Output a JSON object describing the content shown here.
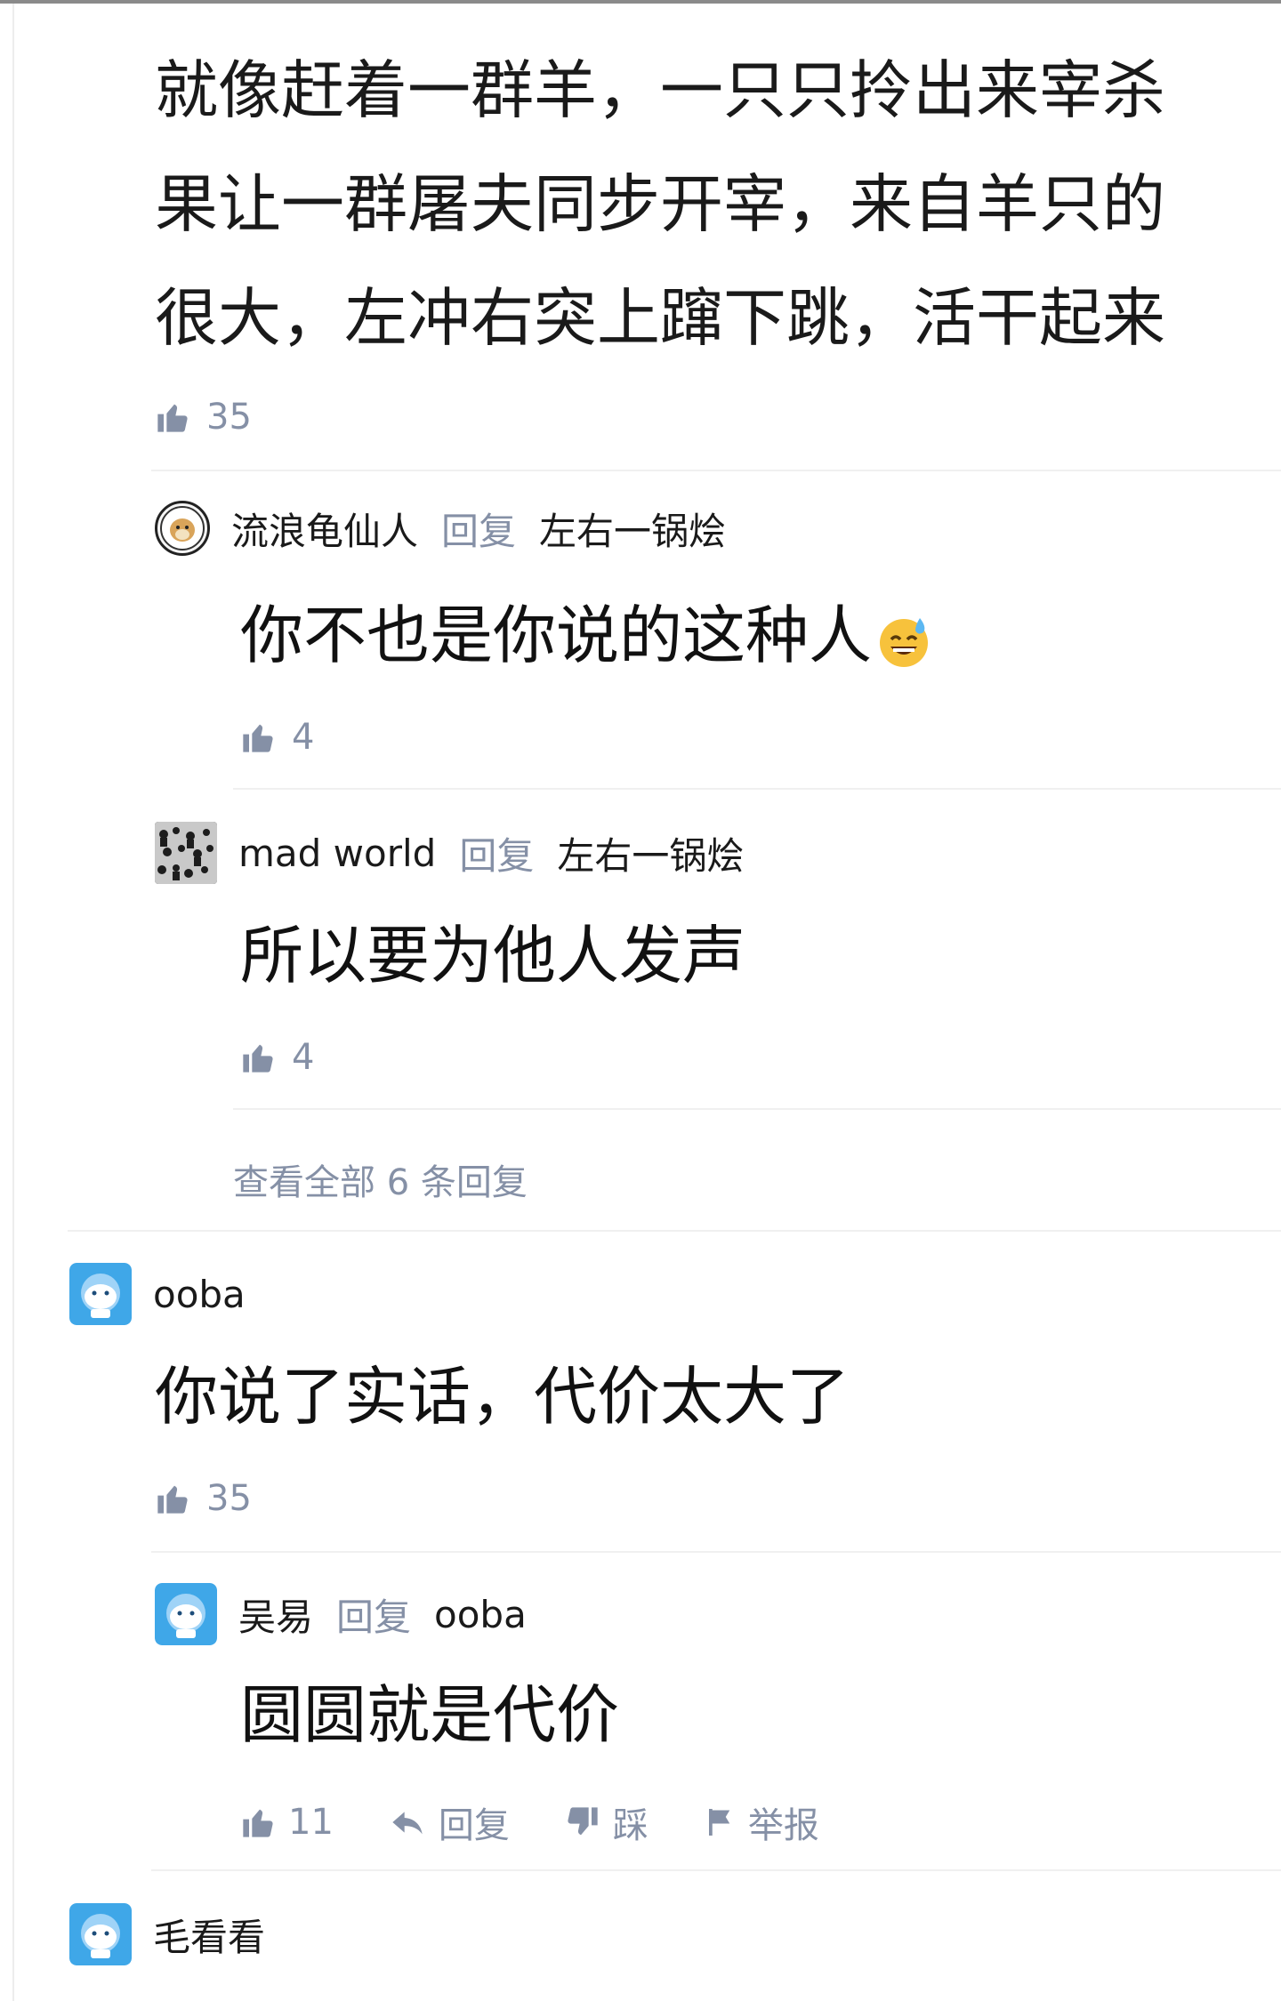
{
  "thread": {
    "top_comment": {
      "lines": [
        "就像赶着一群羊，一只只拎出来宰杀",
        "果让一群屠夫同步开宰，来自羊只的",
        "很大，左冲右突上蹿下跳，活干起来"
      ],
      "likes": "35"
    },
    "replies_1": [
      {
        "author": "流浪龟仙人",
        "reply_word": "回复",
        "reply_to": "左右一锅烩",
        "text": "你不也是你说的这种人",
        "emoji": "sweat-smile",
        "likes": "4"
      },
      {
        "author": "mad world",
        "reply_word": "回复",
        "reply_to": "左右一锅烩",
        "text": "所以要为他人发声",
        "likes": "4"
      }
    ],
    "view_all_replies": "查看全部 6 条回复"
  },
  "comment_ooba": {
    "author": "ooba",
    "text": "你说了实话，代价太大了",
    "likes": "35",
    "reply": {
      "author": "吴易",
      "reply_word": "回复",
      "reply_to": "ooba",
      "text": "圆圆就是代价",
      "likes": "11",
      "actions": {
        "reply": "回复",
        "dislike": "踩",
        "report": "举报"
      }
    }
  },
  "comment_next": {
    "author": "毛看看"
  },
  "colors": {
    "meta_gray": "#8590a6",
    "text": "#1a1a1a",
    "divider": "#f0f0f0",
    "avatar_blue": "#3fa7e8"
  }
}
